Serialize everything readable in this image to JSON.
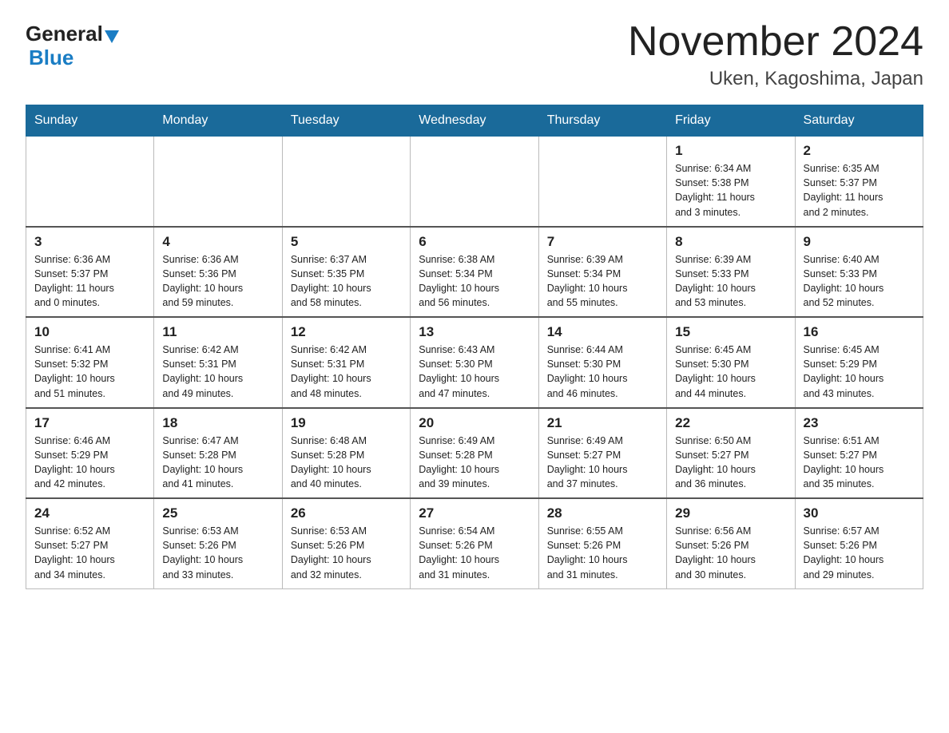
{
  "logo": {
    "general": "General",
    "blue": "Blue"
  },
  "title": "November 2024",
  "subtitle": "Uken, Kagoshima, Japan",
  "days_of_week": [
    "Sunday",
    "Monday",
    "Tuesday",
    "Wednesday",
    "Thursday",
    "Friday",
    "Saturday"
  ],
  "weeks": [
    [
      {
        "day": "",
        "info": ""
      },
      {
        "day": "",
        "info": ""
      },
      {
        "day": "",
        "info": ""
      },
      {
        "day": "",
        "info": ""
      },
      {
        "day": "",
        "info": ""
      },
      {
        "day": "1",
        "info": "Sunrise: 6:34 AM\nSunset: 5:38 PM\nDaylight: 11 hours\nand 3 minutes."
      },
      {
        "day": "2",
        "info": "Sunrise: 6:35 AM\nSunset: 5:37 PM\nDaylight: 11 hours\nand 2 minutes."
      }
    ],
    [
      {
        "day": "3",
        "info": "Sunrise: 6:36 AM\nSunset: 5:37 PM\nDaylight: 11 hours\nand 0 minutes."
      },
      {
        "day": "4",
        "info": "Sunrise: 6:36 AM\nSunset: 5:36 PM\nDaylight: 10 hours\nand 59 minutes."
      },
      {
        "day": "5",
        "info": "Sunrise: 6:37 AM\nSunset: 5:35 PM\nDaylight: 10 hours\nand 58 minutes."
      },
      {
        "day": "6",
        "info": "Sunrise: 6:38 AM\nSunset: 5:34 PM\nDaylight: 10 hours\nand 56 minutes."
      },
      {
        "day": "7",
        "info": "Sunrise: 6:39 AM\nSunset: 5:34 PM\nDaylight: 10 hours\nand 55 minutes."
      },
      {
        "day": "8",
        "info": "Sunrise: 6:39 AM\nSunset: 5:33 PM\nDaylight: 10 hours\nand 53 minutes."
      },
      {
        "day": "9",
        "info": "Sunrise: 6:40 AM\nSunset: 5:33 PM\nDaylight: 10 hours\nand 52 minutes."
      }
    ],
    [
      {
        "day": "10",
        "info": "Sunrise: 6:41 AM\nSunset: 5:32 PM\nDaylight: 10 hours\nand 51 minutes."
      },
      {
        "day": "11",
        "info": "Sunrise: 6:42 AM\nSunset: 5:31 PM\nDaylight: 10 hours\nand 49 minutes."
      },
      {
        "day": "12",
        "info": "Sunrise: 6:42 AM\nSunset: 5:31 PM\nDaylight: 10 hours\nand 48 minutes."
      },
      {
        "day": "13",
        "info": "Sunrise: 6:43 AM\nSunset: 5:30 PM\nDaylight: 10 hours\nand 47 minutes."
      },
      {
        "day": "14",
        "info": "Sunrise: 6:44 AM\nSunset: 5:30 PM\nDaylight: 10 hours\nand 46 minutes."
      },
      {
        "day": "15",
        "info": "Sunrise: 6:45 AM\nSunset: 5:30 PM\nDaylight: 10 hours\nand 44 minutes."
      },
      {
        "day": "16",
        "info": "Sunrise: 6:45 AM\nSunset: 5:29 PM\nDaylight: 10 hours\nand 43 minutes."
      }
    ],
    [
      {
        "day": "17",
        "info": "Sunrise: 6:46 AM\nSunset: 5:29 PM\nDaylight: 10 hours\nand 42 minutes."
      },
      {
        "day": "18",
        "info": "Sunrise: 6:47 AM\nSunset: 5:28 PM\nDaylight: 10 hours\nand 41 minutes."
      },
      {
        "day": "19",
        "info": "Sunrise: 6:48 AM\nSunset: 5:28 PM\nDaylight: 10 hours\nand 40 minutes."
      },
      {
        "day": "20",
        "info": "Sunrise: 6:49 AM\nSunset: 5:28 PM\nDaylight: 10 hours\nand 39 minutes."
      },
      {
        "day": "21",
        "info": "Sunrise: 6:49 AM\nSunset: 5:27 PM\nDaylight: 10 hours\nand 37 minutes."
      },
      {
        "day": "22",
        "info": "Sunrise: 6:50 AM\nSunset: 5:27 PM\nDaylight: 10 hours\nand 36 minutes."
      },
      {
        "day": "23",
        "info": "Sunrise: 6:51 AM\nSunset: 5:27 PM\nDaylight: 10 hours\nand 35 minutes."
      }
    ],
    [
      {
        "day": "24",
        "info": "Sunrise: 6:52 AM\nSunset: 5:27 PM\nDaylight: 10 hours\nand 34 minutes."
      },
      {
        "day": "25",
        "info": "Sunrise: 6:53 AM\nSunset: 5:26 PM\nDaylight: 10 hours\nand 33 minutes."
      },
      {
        "day": "26",
        "info": "Sunrise: 6:53 AM\nSunset: 5:26 PM\nDaylight: 10 hours\nand 32 minutes."
      },
      {
        "day": "27",
        "info": "Sunrise: 6:54 AM\nSunset: 5:26 PM\nDaylight: 10 hours\nand 31 minutes."
      },
      {
        "day": "28",
        "info": "Sunrise: 6:55 AM\nSunset: 5:26 PM\nDaylight: 10 hours\nand 31 minutes."
      },
      {
        "day": "29",
        "info": "Sunrise: 6:56 AM\nSunset: 5:26 PM\nDaylight: 10 hours\nand 30 minutes."
      },
      {
        "day": "30",
        "info": "Sunrise: 6:57 AM\nSunset: 5:26 PM\nDaylight: 10 hours\nand 29 minutes."
      }
    ]
  ]
}
